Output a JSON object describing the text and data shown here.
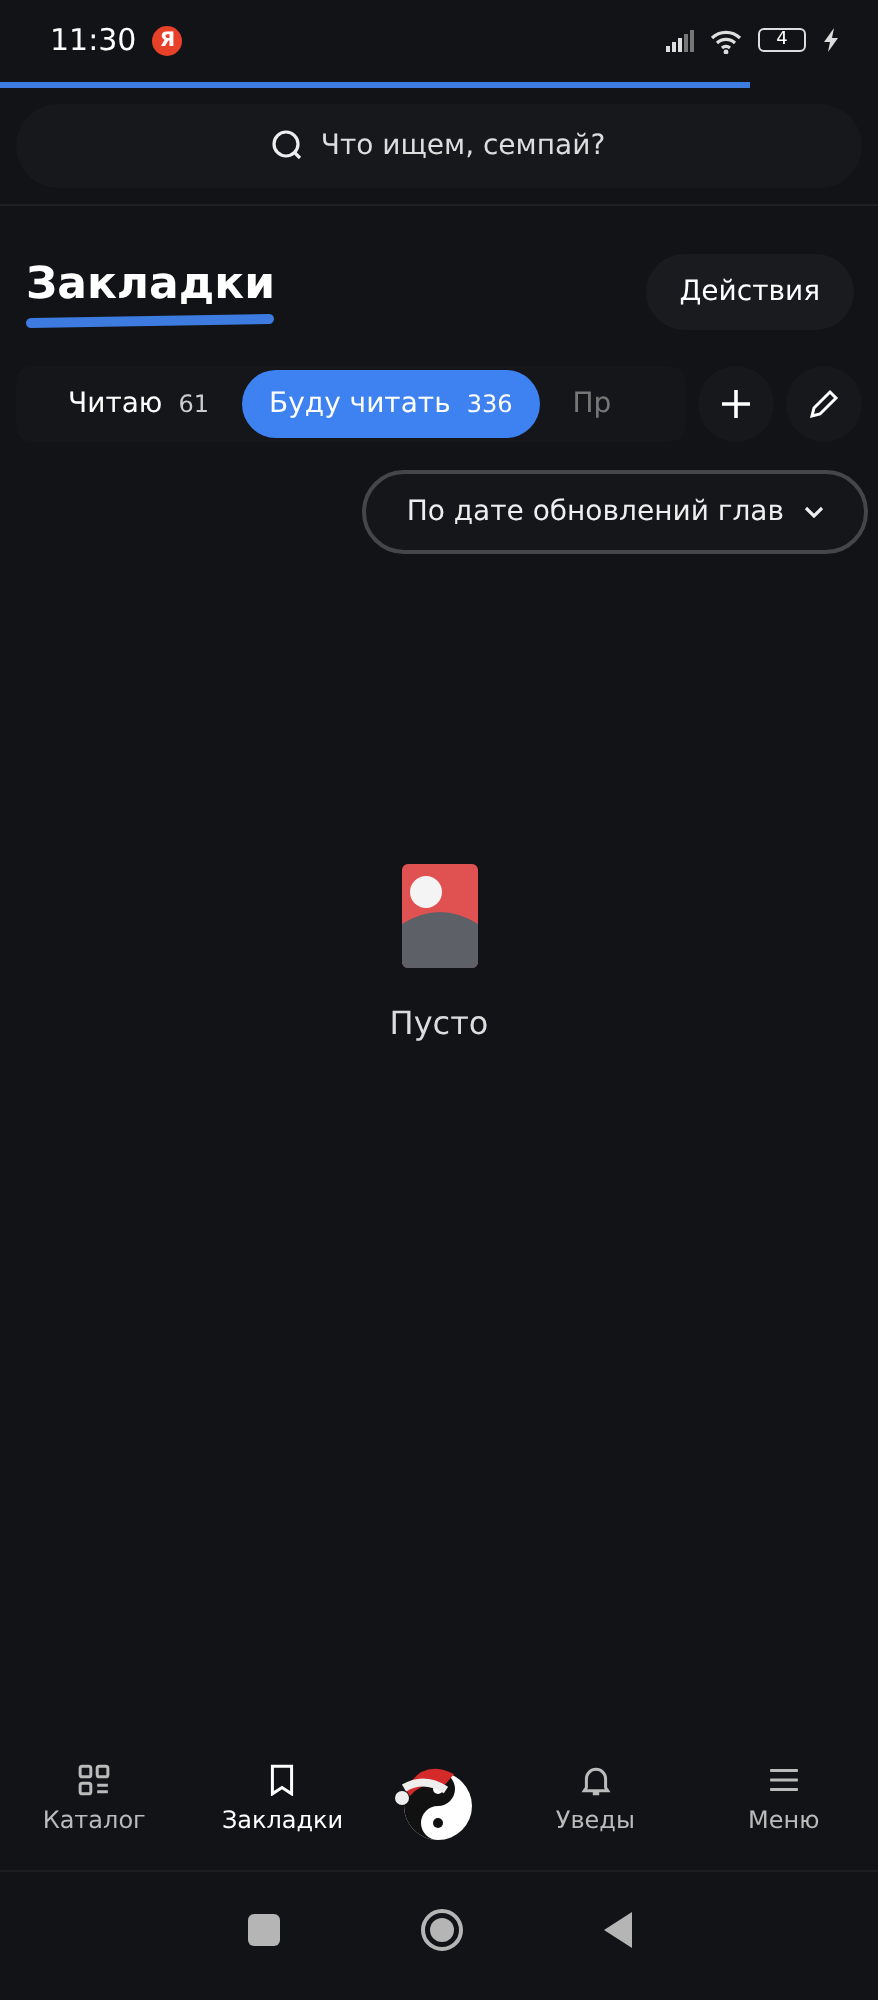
{
  "status_bar": {
    "time": "11:30",
    "app_badge": "Я",
    "battery": "4"
  },
  "loading_bar": {
    "level": 0.855
  },
  "search": {
    "placeholder": "Что ищем, семпай?"
  },
  "header": {
    "title": "Закладки",
    "action": "Действия"
  },
  "tabs": [
    {
      "label": "Читаю",
      "count": "61",
      "selected": false
    },
    {
      "label": "Буду читать",
      "count": "336",
      "selected": true
    },
    {
      "label": "Пр",
      "selected": false
    }
  ],
  "tab_tools": [
    {
      "kind": "add"
    },
    {
      "kind": "edit"
    }
  ],
  "sort": {
    "label": "По дате обновлений глав"
  },
  "empty_state": {
    "text": "Пусто"
  },
  "bottom_nav": [
    {
      "kind": "catalog",
      "label": "Каталог",
      "selected": false
    },
    {
      "kind": "bookmarks",
      "label": "Закладки",
      "selected": true
    },
    {
      "kind": "logo"
    },
    {
      "kind": "bell",
      "label": "Уведы",
      "selected": false
    },
    {
      "kind": "menu",
      "label": "Меню",
      "selected": false
    }
  ],
  "system_nav": [
    {
      "kind": "recents"
    },
    {
      "kind": "home"
    },
    {
      "kind": "back"
    }
  ]
}
